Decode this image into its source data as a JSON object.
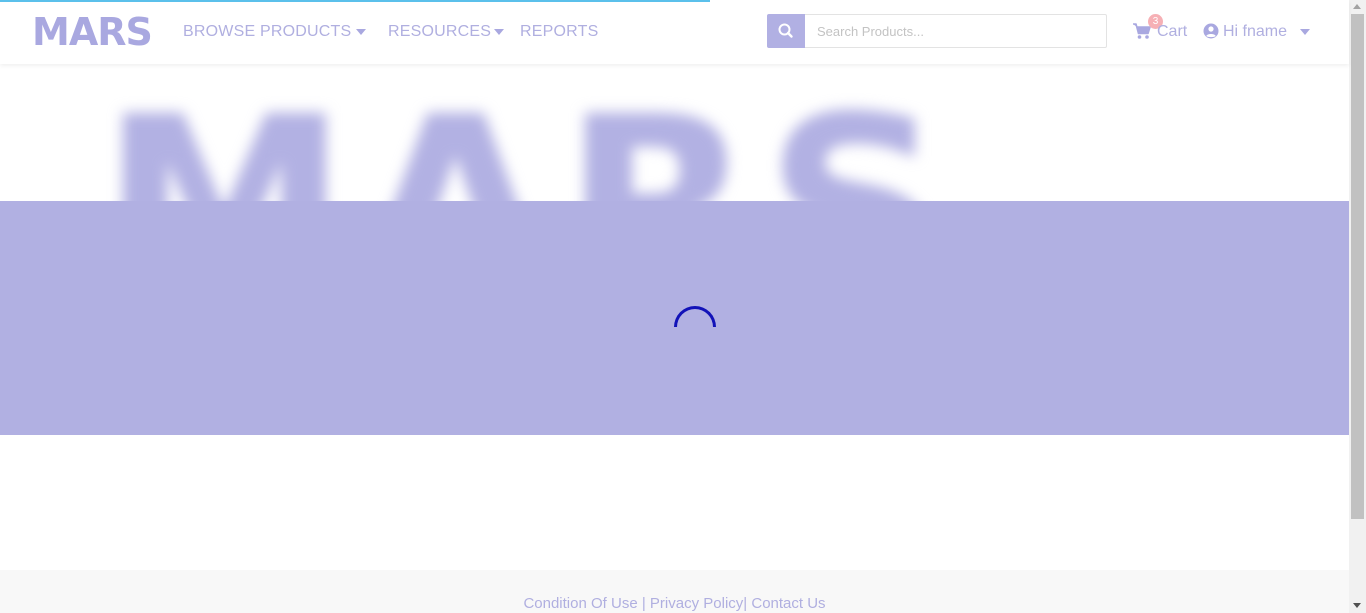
{
  "brand": {
    "logo_text": "MARS",
    "hero_text": "MARS",
    "accent_color": "#b1b0e2",
    "spinner_color": "#1212b8"
  },
  "nav": {
    "items": [
      {
        "label": "BROWSE PRODUCTS",
        "has_dropdown": true
      },
      {
        "label": "RESOURCES",
        "has_dropdown": true
      },
      {
        "label": "REPORTS",
        "has_dropdown": false
      }
    ]
  },
  "search": {
    "placeholder": "Search Products...",
    "value": "",
    "icon": "search-icon"
  },
  "cart": {
    "label": "Cart",
    "count": "3",
    "icon": "shopping-cart-icon"
  },
  "user": {
    "greeting": "Hi fname",
    "icon": "user-circle-icon"
  },
  "loading": {
    "progress": 0.52
  },
  "footer": {
    "links": [
      "Condition Of Use",
      "Privacy Policy",
      "Contact Us"
    ],
    "separator": "|"
  }
}
